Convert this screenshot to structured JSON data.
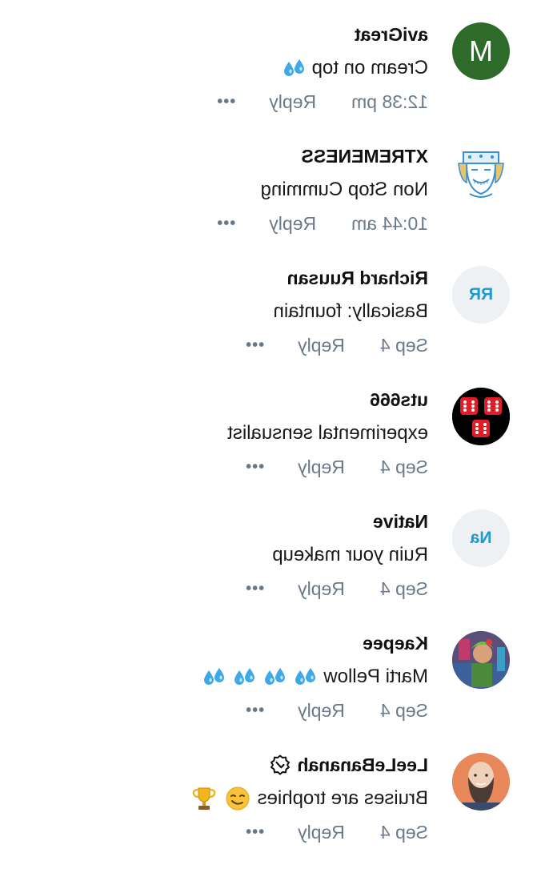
{
  "comments": [
    {
      "username": "aviGreat",
      "text": "Cream on top",
      "time": "12:38 pm",
      "reply": "Reply",
      "more": "•••",
      "avatar": {
        "type": "initial",
        "text": "M",
        "bg": "#2e6b2a"
      },
      "emoji": [
        "sweat-droplets-icon"
      ]
    },
    {
      "username": "XTREMENESS",
      "text": "Non Stop Cumming",
      "time": "10:44 am",
      "reply": "Reply",
      "more": "•••",
      "avatar": {
        "type": "image",
        "description": "cartoon-face-avatar"
      }
    },
    {
      "username": "Richard Ruusan",
      "text": "Basically: fountain",
      "time": "Sep 4",
      "reply": "Reply",
      "more": "•••",
      "avatar": {
        "type": "initials",
        "text": "RR",
        "bg": "#eef1f4",
        "color": "#1d9bd1"
      }
    },
    {
      "username": "uts666",
      "text": "experimental sensualist",
      "time": "Sep 4",
      "reply": "Reply",
      "more": "•••",
      "avatar": {
        "type": "image",
        "description": "red-dice-avatar",
        "bg": "#000000"
      }
    },
    {
      "username": "Native",
      "text": "Ruin your makeup",
      "time": "Sep 4",
      "reply": "Reply",
      "more": "•••",
      "avatar": {
        "type": "initials",
        "text": "Na",
        "bg": "#eef1f4",
        "color": "#1d9bd1"
      }
    },
    {
      "username": "Kaepee",
      "text": "Marti Pellow",
      "time": "Sep 4",
      "reply": "Reply",
      "more": "•••",
      "avatar": {
        "type": "image",
        "description": "photo-avatar"
      },
      "emoji": [
        "sweat-droplets-icon",
        "sweat-droplets-icon",
        "sweat-droplets-icon",
        "sweat-droplets-icon"
      ]
    },
    {
      "username": "LeeLeBananah",
      "text": "Bruises are trophies",
      "time": "Sep 4",
      "reply": "Reply",
      "more": "•••",
      "avatar": {
        "type": "image",
        "description": "bearded-man-avatar"
      },
      "badge": "verified-icon",
      "emoji": [
        "smirking-face-icon",
        "trophy-icon"
      ]
    }
  ],
  "colors": {
    "username": "#111111",
    "text": "#1a1a1a",
    "meta": "#6b7a8a",
    "initials_blue": "#1d9bd1",
    "droplet_blue": "#3fa9e8"
  }
}
